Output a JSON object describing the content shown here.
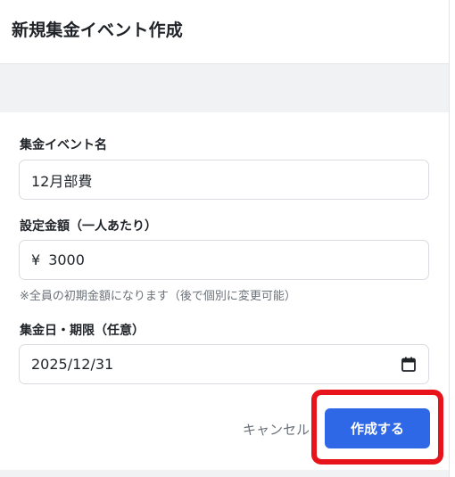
{
  "header": {
    "title": "新規集金イベント作成"
  },
  "form": {
    "event_name": {
      "label": "集金イベント名",
      "value": "12月部費"
    },
    "amount": {
      "label": "設定金額（一人あたり）",
      "currency_symbol": "¥",
      "value": "3000",
      "hint": "※全員の初期金額になります（後で個別に変更可能）"
    },
    "date": {
      "label": "集金日・期限（任意）",
      "value": "2025/12/31",
      "icon": "calendar-icon"
    }
  },
  "actions": {
    "cancel_label": "キャンセル",
    "create_label": "作成する",
    "primary_color": "#2f68e6",
    "highlight_color": "#e8141b"
  }
}
